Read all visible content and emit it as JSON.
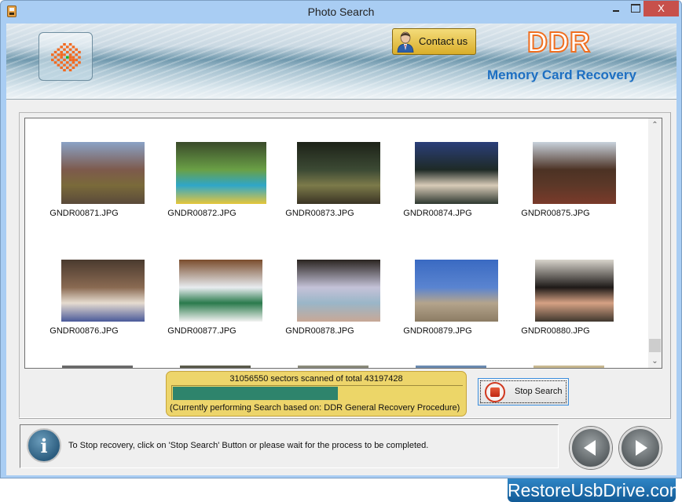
{
  "window": {
    "title": "Photo Search",
    "close_label": "X"
  },
  "banner": {
    "contact_label": "Contact us",
    "brand_logo": "DDR",
    "product_name": "Memory Card Recovery"
  },
  "gallery": {
    "items": [
      {
        "filename": "GNDR00871.JPG",
        "colors": [
          "#8aa2c6",
          "#7d5a4c",
          "#7a6a3a",
          "#5a4a3a"
        ]
      },
      {
        "filename": "GNDR00872.JPG",
        "colors": [
          "#3a4a2a",
          "#6aa046",
          "#2fa6c8",
          "#e6c63a"
        ]
      },
      {
        "filename": "GNDR00873.JPG",
        "colors": [
          "#1d2218",
          "#3c4a34",
          "#7c7a4a",
          "#3a3424"
        ]
      },
      {
        "filename": "GNDR00874.JPG",
        "colors": [
          "#2b3f7a",
          "#1e2a26",
          "#d8cbb8",
          "#2e3830"
        ]
      },
      {
        "filename": "GNDR00875.JPG",
        "colors": [
          "#c8d2dc",
          "#4c3224",
          "#5c3828",
          "#7a3a2a"
        ]
      },
      {
        "filename": "GNDR00876.JPG",
        "colors": [
          "#4a3a2e",
          "#8a6a52",
          "#e6dcd0",
          "#4a5a9a"
        ]
      },
      {
        "filename": "GNDR00877.JPG",
        "colors": [
          "#7a4c2c",
          "#e8ecf0",
          "#2a7a4c",
          "#f2f2f2"
        ]
      },
      {
        "filename": "GNDR00878.JPG",
        "colors": [
          "#2a2420",
          "#c4c2d8",
          "#9ab6c8",
          "#c8a896"
        ]
      },
      {
        "filename": "GNDR00879.JPG",
        "colors": [
          "#3a6ac2",
          "#5a84d0",
          "#b4a48c",
          "#8c7c64"
        ]
      },
      {
        "filename": "GNDR00880.JPG",
        "colors": [
          "#d8d4cc",
          "#1e1a18",
          "#d6a284",
          "#40382e"
        ]
      }
    ]
  },
  "progress": {
    "sectors_scanned": 31056550,
    "sectors_total": 43197428,
    "status_text": "31056550 sectors scanned of total 43197428",
    "fill_percent": 57,
    "procedure_text": "(Currently performing Search based on:  DDR General Recovery Procedure)"
  },
  "actions": {
    "stop_search_label": "Stop Search"
  },
  "info": {
    "message": "To Stop recovery, click on 'Stop Search' Button or please wait for the process to be completed."
  },
  "footer": {
    "brand_text": "RestoreUsbDrive.com"
  },
  "colors": {
    "progress_fill": "#2e846c",
    "progress_panel": "#edd56b",
    "brand_orange": "#f06f20",
    "product_blue": "#1d6fc2",
    "close_red": "#c7504b"
  }
}
